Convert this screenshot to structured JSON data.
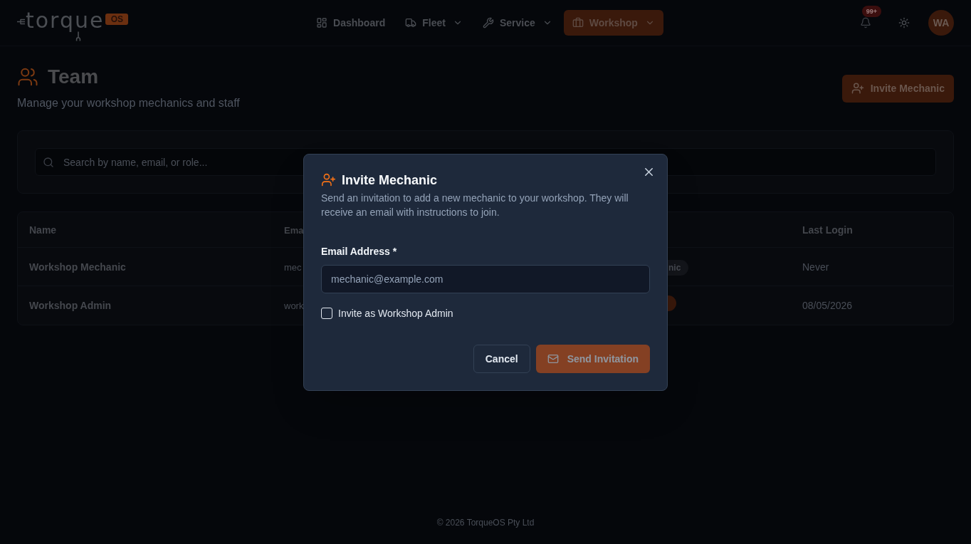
{
  "header": {
    "logo": {
      "wordmark": "torque",
      "badge": "OS"
    },
    "nav": [
      {
        "label": "Dashboard",
        "has_menu": false,
        "selected": false
      },
      {
        "label": "Fleet",
        "has_menu": true,
        "selected": false
      },
      {
        "label": "Service",
        "has_menu": true,
        "selected": false
      },
      {
        "label": "Workshop",
        "has_menu": true,
        "selected": true
      }
    ],
    "notifications": {
      "count": "99+"
    },
    "avatar": {
      "initials": "WA"
    }
  },
  "page": {
    "title": "Team",
    "subtitle": "Manage your workshop mechanics and staff",
    "action": {
      "label": "Invite Mechanic"
    }
  },
  "search": {
    "placeholder": "Search by name, email, or role..."
  },
  "table": {
    "columns": [
      "Name",
      "Ema",
      "Last Login"
    ],
    "rows": [
      {
        "name": "Workshop Mechanic",
        "column_2": "mec",
        "column_3": {
          "text": "nic",
          "color": "#13151a"
        },
        "last_login": "Never"
      },
      {
        "name": "Workshop Admin",
        "column_2": "work",
        "column_3": {
          "color": "#3a190b"
        },
        "last_login": "08/05/2026"
      }
    ]
  },
  "footer": {
    "text": "© 2026 TorqueOS Pty Ltd"
  },
  "dialog": {
    "title": "Invite Mechanic",
    "description": "Send an invitation to add a new mechanic to your workshop. They will receive an email with instructions to join.",
    "field": {
      "label": "Email Address *",
      "placeholder": "mechanic@example.com"
    },
    "checkbox": {
      "label": "Invite as Workshop Admin",
      "checked": false
    },
    "buttons": [
      {
        "label": "Cancel",
        "kind": "secondary",
        "disabled": false
      },
      {
        "label": "Send Invitation",
        "kind": "primary",
        "disabled": true
      }
    ]
  }
}
